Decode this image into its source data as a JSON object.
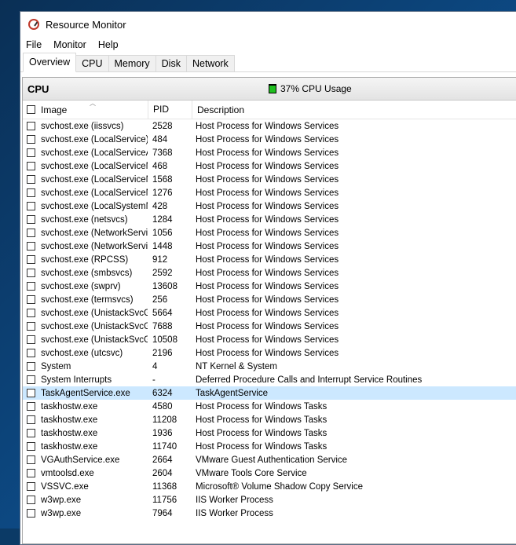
{
  "window": {
    "title": "Resource Monitor"
  },
  "menu": [
    "File",
    "Monitor",
    "Help"
  ],
  "tabs": [
    "Overview",
    "CPU",
    "Memory",
    "Disk",
    "Network"
  ],
  "active_tab": "Overview",
  "cpu_section": {
    "title": "CPU",
    "usage_text": "37% CPU Usage",
    "usage_percent": 37
  },
  "columns": {
    "image": "Image",
    "pid": "PID",
    "description": "Description"
  },
  "rows": [
    {
      "image": "svchost.exe (iissvcs)",
      "pid": "2528",
      "desc": "Host Process for Windows Services"
    },
    {
      "image": "svchost.exe (LocalService)",
      "pid": "484",
      "desc": "Host Process for Windows Services"
    },
    {
      "image": "svchost.exe (LocalServiceAn...",
      "pid": "7368",
      "desc": "Host Process for Windows Services"
    },
    {
      "image": "svchost.exe (LocalServiceNet...",
      "pid": "468",
      "desc": "Host Process for Windows Services"
    },
    {
      "image": "svchost.exe (LocalServiceNet...",
      "pid": "1568",
      "desc": "Host Process for Windows Services"
    },
    {
      "image": "svchost.exe (LocalServiceNo...",
      "pid": "1276",
      "desc": "Host Process for Windows Services"
    },
    {
      "image": "svchost.exe (LocalSystemNet...",
      "pid": "428",
      "desc": "Host Process for Windows Services"
    },
    {
      "image": "svchost.exe (netsvcs)",
      "pid": "1284",
      "desc": "Host Process for Windows Services"
    },
    {
      "image": "svchost.exe (NetworkService)",
      "pid": "1056",
      "desc": "Host Process for Windows Services"
    },
    {
      "image": "svchost.exe (NetworkService...",
      "pid": "1448",
      "desc": "Host Process for Windows Services"
    },
    {
      "image": "svchost.exe (RPCSS)",
      "pid": "912",
      "desc": "Host Process for Windows Services"
    },
    {
      "image": "svchost.exe (smbsvcs)",
      "pid": "2592",
      "desc": "Host Process for Windows Services"
    },
    {
      "image": "svchost.exe (swprv)",
      "pid": "13608",
      "desc": "Host Process for Windows Services"
    },
    {
      "image": "svchost.exe (termsvcs)",
      "pid": "256",
      "desc": "Host Process for Windows Services"
    },
    {
      "image": "svchost.exe (UnistackSvcGro...",
      "pid": "5664",
      "desc": "Host Process for Windows Services"
    },
    {
      "image": "svchost.exe (UnistackSvcGro...",
      "pid": "7688",
      "desc": "Host Process for Windows Services"
    },
    {
      "image": "svchost.exe (UnistackSvcGro...",
      "pid": "10508",
      "desc": "Host Process for Windows Services"
    },
    {
      "image": "svchost.exe (utcsvc)",
      "pid": "2196",
      "desc": "Host Process for Windows Services"
    },
    {
      "image": "System",
      "pid": "4",
      "desc": "NT Kernel & System"
    },
    {
      "image": "System Interrupts",
      "pid": "-",
      "desc": "Deferred Procedure Calls and Interrupt Service Routines"
    },
    {
      "image": "TaskAgentService.exe",
      "pid": "6324",
      "desc": "TaskAgentService",
      "selected": true
    },
    {
      "image": "taskhostw.exe",
      "pid": "4580",
      "desc": "Host Process for Windows Tasks"
    },
    {
      "image": "taskhostw.exe",
      "pid": "11208",
      "desc": "Host Process for Windows Tasks"
    },
    {
      "image": "taskhostw.exe",
      "pid": "1936",
      "desc": "Host Process for Windows Tasks"
    },
    {
      "image": "taskhostw.exe",
      "pid": "11740",
      "desc": "Host Process for Windows Tasks"
    },
    {
      "image": "VGAuthService.exe",
      "pid": "2664",
      "desc": "VMware Guest Authentication Service"
    },
    {
      "image": "vmtoolsd.exe",
      "pid": "2604",
      "desc": "VMware Tools Core Service"
    },
    {
      "image": "VSSVC.exe",
      "pid": "11368",
      "desc": "Microsoft® Volume Shadow Copy Service"
    },
    {
      "image": "w3wp.exe",
      "pid": "11756",
      "desc": "IIS Worker Process"
    },
    {
      "image": "w3wp.exe",
      "pid": "7964",
      "desc": "IIS Worker Process"
    }
  ]
}
